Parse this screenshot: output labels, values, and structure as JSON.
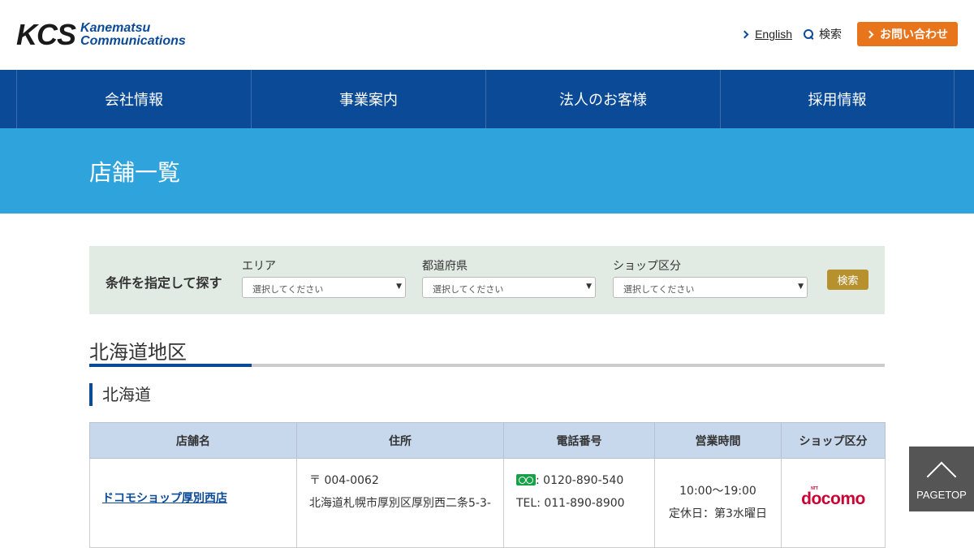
{
  "header": {
    "logo_mark": "KCS",
    "logo_line1": "Kanematsu",
    "logo_line2": "Communications",
    "english_label": "English",
    "search_label": "検索",
    "contact_label": "お問い合わせ"
  },
  "nav": {
    "items": [
      {
        "label": "会社情報"
      },
      {
        "label": "事業案内"
      },
      {
        "label": "法人のお客様"
      },
      {
        "label": "採用情報"
      }
    ]
  },
  "page": {
    "title": "店舗一覧"
  },
  "filter": {
    "label": "条件を指定して探す",
    "area": {
      "caption": "エリア",
      "selected": "選択してください"
    },
    "prefecture": {
      "caption": "都道府県",
      "selected": "選択してください"
    },
    "shop_type": {
      "caption": "ショップ区分",
      "selected": "選択してください"
    },
    "search_button": "検索"
  },
  "section": {
    "title": "北海道地区",
    "subtitle": "北海道"
  },
  "table": {
    "headers": [
      "店舗名",
      "住所",
      "電話番号",
      "営業時間",
      "ショップ区分"
    ],
    "rows": [
      {
        "name": "ドコモショップ厚別西店",
        "postal": "〒 004-0062",
        "address": "北海道札幌市厚別区厚別西二条5-3-",
        "freedial": ": 0120-890-540",
        "tel": "TEL: 011-890-8900",
        "hours": "10:00～19:00",
        "closed": "定休日：第3水曜日",
        "type_logo": "docomo",
        "type_logo_small": "NTT"
      }
    ]
  },
  "pagetop": {
    "label": "PAGETOP"
  },
  "colors": {
    "nav_bg": "#0a4a97",
    "band_bg": "#2ea3dc",
    "contact_bg": "#e8741c",
    "find_button_bg": "#b8912f",
    "filter_bg": "#e2ebe3",
    "table_header_bg": "#c8d8ec",
    "docomo_red": "#cc0033"
  }
}
